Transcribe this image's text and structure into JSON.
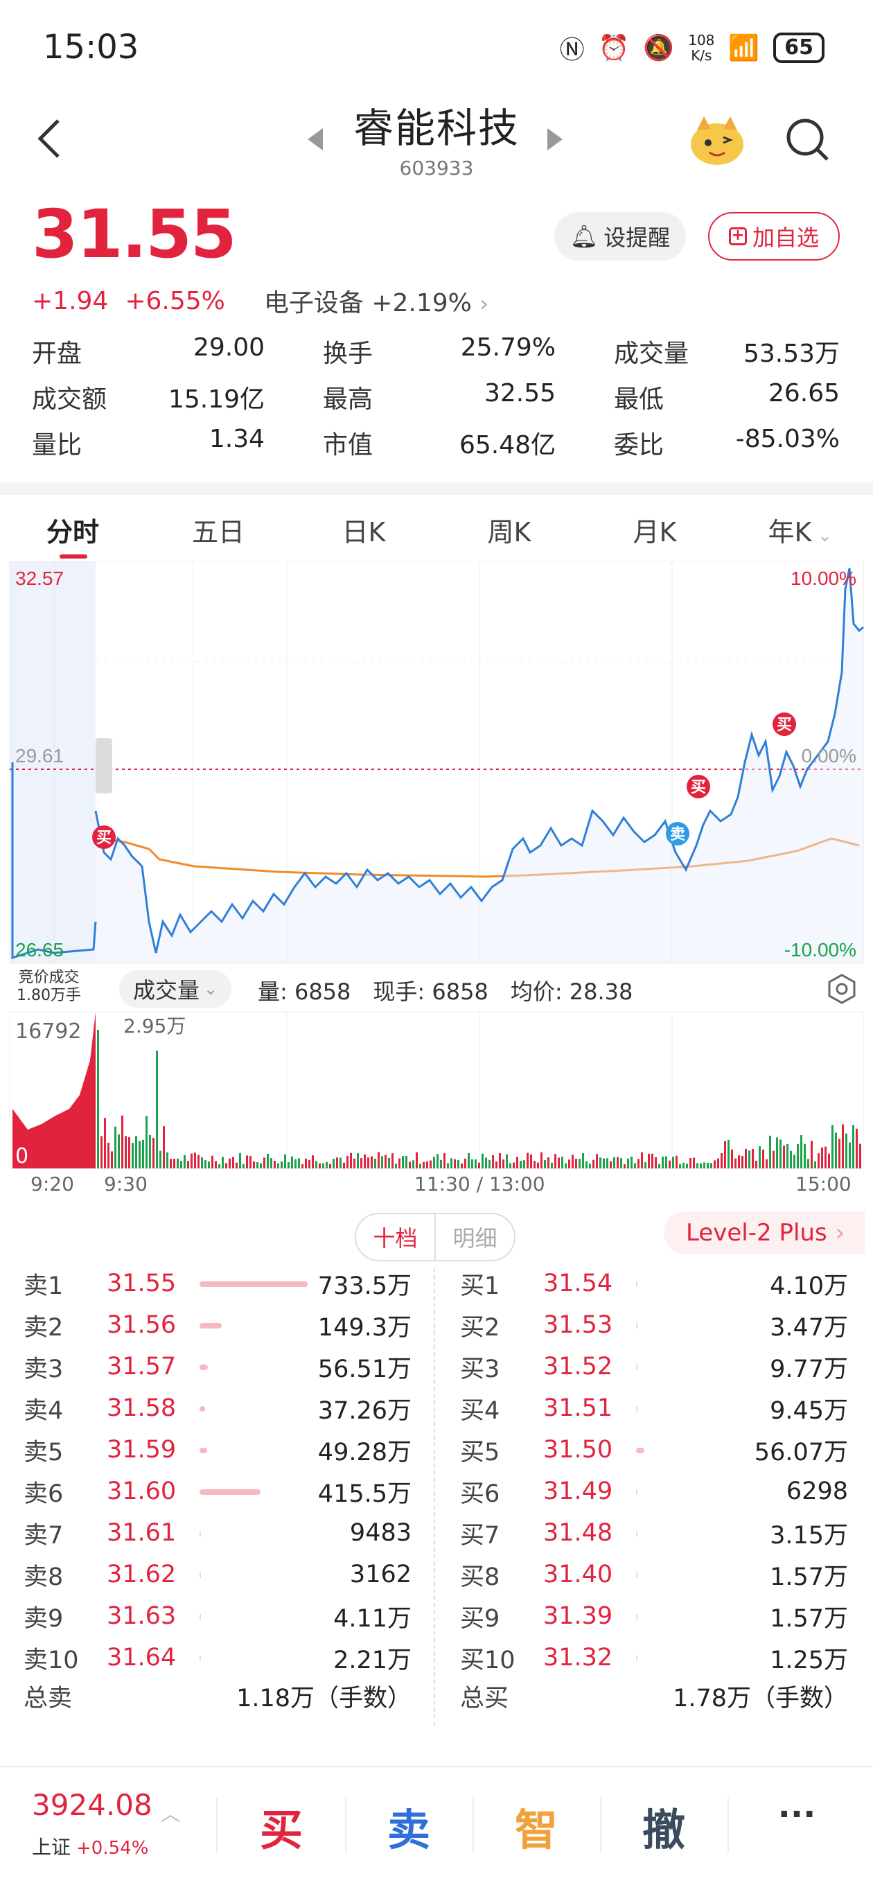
{
  "status_bar": {
    "time": "15:03",
    "net_speed_value": "108",
    "net_speed_unit": "K/s",
    "battery": "65"
  },
  "header": {
    "stock_name": "睿能科技",
    "stock_code": "603933"
  },
  "quote": {
    "price": "31.55",
    "change": "+1.94",
    "change_pct": "+6.55%",
    "sector": "电子设备 +2.19%",
    "alert_label": "设提醒",
    "watch_label": "加自选",
    "rows": [
      [
        {
          "k": "开盘",
          "v": "29.00",
          "c": "green"
        },
        {
          "k": "换手",
          "v": "25.79%",
          "c": ""
        },
        {
          "k": "成交量",
          "v": "53.53万",
          "c": ""
        }
      ],
      [
        {
          "k": "成交额",
          "v": "15.19亿",
          "c": ""
        },
        {
          "k": "最高",
          "v": "32.55",
          "c": "red"
        },
        {
          "k": "最低",
          "v": "26.65",
          "c": "green"
        }
      ],
      [
        {
          "k": "量比",
          "v": "1.34",
          "c": ""
        },
        {
          "k": "市值",
          "v": "65.48亿",
          "c": ""
        },
        {
          "k": "委比",
          "v": "-85.03%",
          "c": "green"
        }
      ]
    ]
  },
  "tabs": [
    "分时",
    "五日",
    "日K",
    "周K",
    "月K",
    "年K"
  ],
  "chart": {
    "y_top": "32.57",
    "y_mid": "29.61",
    "y_bottom": "26.65",
    "pct_top": "10.00%",
    "pct_mid": "0.00%",
    "pct_bottom": "-10.00%",
    "buy_marker": "买",
    "sell_marker": "卖",
    "auction_line1": "竞价成交",
    "auction_line2": "1.80万手",
    "indicator": "成交量",
    "vol_info": "量: 6858",
    "hand_info": "现手: 6858",
    "avg_info": "均价: 28.38",
    "vol_max_left": "16792",
    "vol_peak_label": "2.95万",
    "vol_zero": "0",
    "time_labels": [
      "9:20",
      "9:30",
      "11:30 / 13:00",
      "15:00"
    ]
  },
  "orderbook": {
    "tab_active": "十档",
    "tab_other": "明细",
    "level2": "Level-2 Plus",
    "sells": [
      {
        "label": "卖1",
        "price": "31.55",
        "vol": "733.5万",
        "share": 0.177
      },
      {
        "label": "卖2",
        "price": "31.56",
        "vol": "149.3万",
        "share": 0.036
      },
      {
        "label": "卖3",
        "price": "31.57",
        "vol": "56.51万",
        "share": 0.014
      },
      {
        "label": "卖4",
        "price": "31.58",
        "vol": "37.26万",
        "share": 0.009
      },
      {
        "label": "卖5",
        "price": "31.59",
        "vol": "49.28万",
        "share": 0.012
      },
      {
        "label": "卖6",
        "price": "31.60",
        "vol": "415.5万",
        "share": 0.1
      },
      {
        "label": "卖7",
        "price": "31.61",
        "vol": "9483",
        "share": 0
      },
      {
        "label": "卖8",
        "price": "31.62",
        "vol": "3162",
        "share": 0
      },
      {
        "label": "卖9",
        "price": "31.63",
        "vol": "4.11万",
        "share": 0
      },
      {
        "label": "卖10",
        "price": "31.64",
        "vol": "2.21万",
        "share": 0
      }
    ],
    "buys": [
      {
        "label": "买1",
        "price": "31.54",
        "vol": "4.10万",
        "share": 0
      },
      {
        "label": "买2",
        "price": "31.53",
        "vol": "3.47万",
        "share": 0
      },
      {
        "label": "买3",
        "price": "31.52",
        "vol": "9.77万",
        "share": 0
      },
      {
        "label": "买4",
        "price": "31.51",
        "vol": "9.45万",
        "share": 0
      },
      {
        "label": "买5",
        "price": "31.50",
        "vol": "56.07万",
        "share": 0.014
      },
      {
        "label": "买6",
        "price": "31.49",
        "vol": "6298",
        "share": 0
      },
      {
        "label": "买7",
        "price": "31.48",
        "vol": "3.15万",
        "share": 0
      },
      {
        "label": "买8",
        "price": "31.40",
        "vol": "1.57万",
        "share": 0
      },
      {
        "label": "买9",
        "price": "31.39",
        "vol": "1.57万",
        "share": 0
      },
      {
        "label": "买10",
        "price": "31.32",
        "vol": "1.25万",
        "share": 0
      }
    ],
    "total_sell_label": "总卖",
    "total_sell": "1.18万（手数）",
    "total_buy_label": "总买",
    "total_buy": "1.78万（手数）"
  },
  "bottom_bar": {
    "index_value": "3924.08",
    "index_name": "上证",
    "index_pct": "+0.54%",
    "buy": "买",
    "sell": "卖",
    "smart": "智",
    "cancel": "撤",
    "more": "···"
  },
  "colors": {
    "up": "#e2233e",
    "down": "#1aa34a",
    "price_line": "#2f7fd8",
    "avg_line": "#f08a2c",
    "sell_marker": "#2f9be6"
  }
}
